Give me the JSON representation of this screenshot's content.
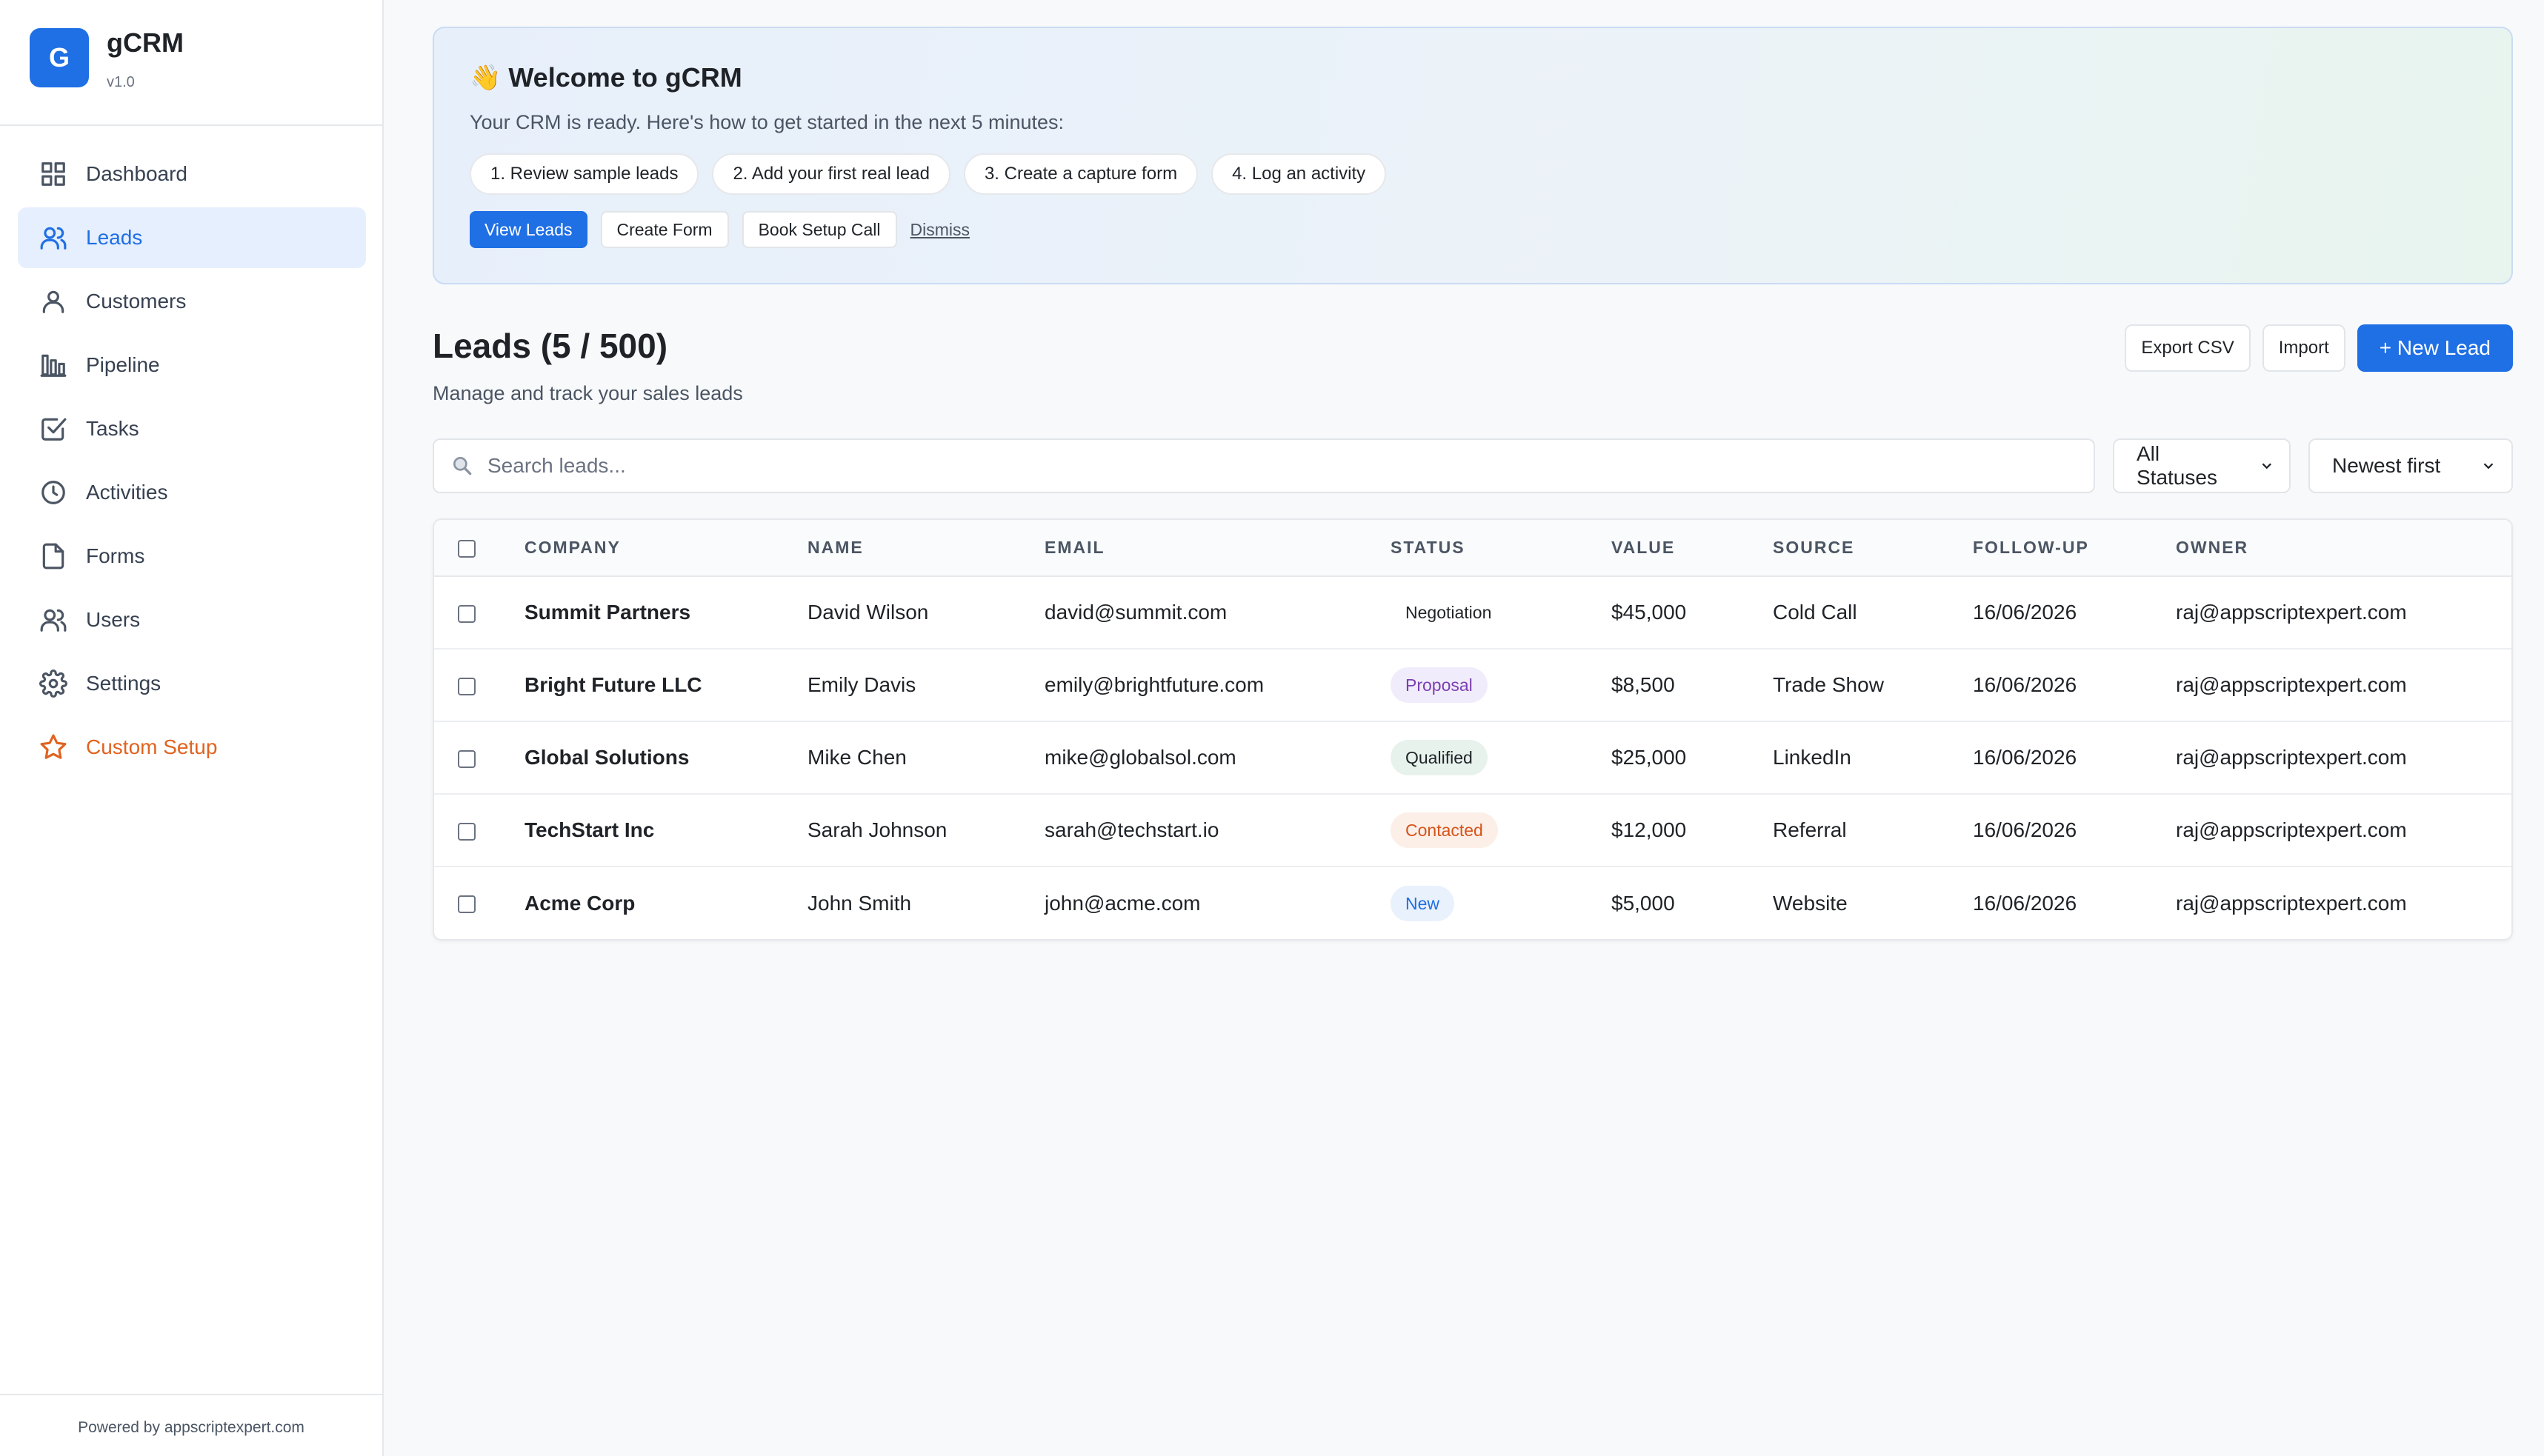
{
  "app": {
    "logo_letter": "G",
    "name": "gCRM",
    "version": "v1.0",
    "footer": "Powered by appscriptexpert.com"
  },
  "sidebar": {
    "items": [
      {
        "label": "Dashboard",
        "icon": "grid-icon"
      },
      {
        "label": "Leads",
        "icon": "users-icon",
        "active": true
      },
      {
        "label": "Customers",
        "icon": "user-icon"
      },
      {
        "label": "Pipeline",
        "icon": "bar-chart-icon"
      },
      {
        "label": "Tasks",
        "icon": "check-square-icon"
      },
      {
        "label": "Activities",
        "icon": "clock-icon"
      },
      {
        "label": "Forms",
        "icon": "file-icon"
      },
      {
        "label": "Users",
        "icon": "users-icon"
      },
      {
        "label": "Settings",
        "icon": "gear-icon"
      },
      {
        "label": "Custom Setup",
        "icon": "star-icon",
        "accent": true
      }
    ]
  },
  "welcome": {
    "emoji": "👋",
    "title": "Welcome to gCRM",
    "subtitle": "Your CRM is ready. Here's how to get started in the next 5 minutes:",
    "steps": [
      "1. Review sample leads",
      "2. Add your first real lead",
      "3. Create a capture form",
      "4. Log an activity"
    ],
    "actions": {
      "view_leads": "View Leads",
      "create_form": "Create Form",
      "book_call": "Book Setup Call",
      "dismiss": "Dismiss"
    }
  },
  "page": {
    "title": "Leads (5 / 500)",
    "subtitle": "Manage and track your sales leads",
    "export": "Export CSV",
    "import": "Import",
    "new_lead": "+ New Lead"
  },
  "filters": {
    "search_placeholder": "Search leads...",
    "status": "All Statuses",
    "sort": "Newest first"
  },
  "table": {
    "columns": [
      "COMPANY",
      "NAME",
      "EMAIL",
      "STATUS",
      "VALUE",
      "SOURCE",
      "FOLLOW-UP",
      "OWNER"
    ],
    "rows": [
      {
        "company": "Summit Partners",
        "name": "David Wilson",
        "email": "david@summit.com",
        "status": "Negotiation",
        "value": "$45,000",
        "source": "Cold Call",
        "followup": "16/06/2026",
        "owner": "raj@appscriptexpert.com"
      },
      {
        "company": "Bright Future LLC",
        "name": "Emily Davis",
        "email": "emily@brightfuture.com",
        "status": "Proposal",
        "value": "$8,500",
        "source": "Trade Show",
        "followup": "16/06/2026",
        "owner": "raj@appscriptexpert.com"
      },
      {
        "company": "Global Solutions",
        "name": "Mike Chen",
        "email": "mike@globalsol.com",
        "status": "Qualified",
        "value": "$25,000",
        "source": "LinkedIn",
        "followup": "16/06/2026",
        "owner": "raj@appscriptexpert.com"
      },
      {
        "company": "TechStart Inc",
        "name": "Sarah Johnson",
        "email": "sarah@techstart.io",
        "status": "Contacted",
        "value": "$12,000",
        "source": "Referral",
        "followup": "16/06/2026",
        "owner": "raj@appscriptexpert.com"
      },
      {
        "company": "Acme Corp",
        "name": "John Smith",
        "email": "john@acme.com",
        "status": "New",
        "value": "$5,000",
        "source": "Website",
        "followup": "16/06/2026",
        "owner": "raj@appscriptexpert.com"
      }
    ]
  },
  "colors": {
    "primary": "#1f6fe5",
    "accent": "#e0631f",
    "status_proposal": "#7b3fb2",
    "status_contacted": "#d6531b",
    "status_new": "#1f6fe5"
  }
}
